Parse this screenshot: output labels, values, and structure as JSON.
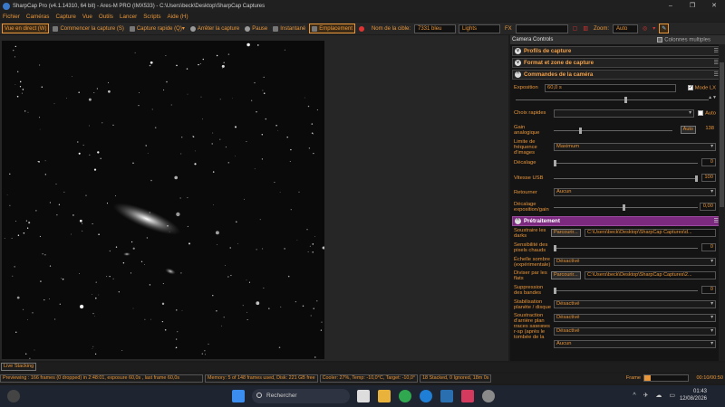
{
  "window": {
    "title": "SharpCap Pro (v4.1.14310, 64 bit) - Ares-M PRO (IMX533) - C:\\Users\\beck\\Desktop\\SharpCap Captures",
    "controls": [
      "–",
      "❐",
      "✕"
    ]
  },
  "menu": [
    "Fichier",
    "Caméras",
    "Capture",
    "Vue",
    "Outils",
    "Lancer",
    "Scripts",
    "Aide (H)"
  ],
  "toolbar": {
    "live_view": "Vue en direct (W)",
    "start_capture": "Commencer la capture (S)",
    "quick_capture": "Capture rapide (Q)",
    "stop_capture": "Arrêter la capture",
    "pause": "Pause",
    "snapshot": "Instantané",
    "framing": "Emplacement",
    "target_label": "Nom de la cible:",
    "target_value": "7331 bleu",
    "frame_type": "Lights",
    "fx_label": "FX",
    "zoom_label": "Zoom:",
    "zoom_value": "Auto"
  },
  "panel": {
    "header": "Camera Controls",
    "multi_columns": "Colonnes multiples",
    "sections": {
      "profiles": "Profils de capture",
      "format": "Format et zone de capture",
      "camera": "Commandes de la caméra",
      "preprocessing": "Prétraitement"
    },
    "camera_controls": {
      "exposure_label": "Exposition",
      "exposure_value": "60,0 s",
      "lx_mode": "Mode LX",
      "lx_checked": true,
      "quick_choice": "Choix rapides",
      "auto_label": "Auto",
      "gain_label": "Gain analogique",
      "gain_auto": "Auto",
      "gain_value": "138",
      "framerate_label": "Limite de fréquence d'images",
      "framerate_value": "Maximum",
      "offset_label": "Décalage",
      "offset_value": "0",
      "usb_label": "Vitesse USB",
      "usb_value": "100",
      "flip_label": "Retourner",
      "flip_value": "Aucun",
      "expgain_label": "Décalage exposition/gain",
      "expgain_value": "0,00"
    },
    "preprocessing": {
      "darks_label": "Soustraire les darks",
      "browse": "Parcourir...",
      "darks_path": "C:\\Users\\beck\\Desktop\\SharpCap Captures\\d...",
      "hotpix_label": "Sensibilité des pixels chauds",
      "hotpix_value": "0",
      "darkscale_label": "Échelle sombre (expérimentale)",
      "darkscale_value": "Désactivé",
      "flats_label": "Diviser par les flats",
      "flats_path": "C:\\Users\\beck\\Desktop\\SharpCap Captures\\2...",
      "banding_label": "Suppression des bandes",
      "banding_value": "0",
      "stab_label": "Stabilisation planète / disque",
      "stab_value": "Désactivé",
      "bg_label": "Soustraction d'arrière plan",
      "bg_value": "Désactivé",
      "sat_label": "Supprimer les traces satellites r-sp (après le tombée de la nuit)",
      "sat_value": "Désactivé",
      "last_value": "Aucun"
    }
  },
  "live_stacking": "Live Stacking",
  "status": {
    "preview": "Previewing : 166 frames (0 dropped) in 2:48:01, exposure 60,0s , last frame 60,0s",
    "memory": "Memory: 5 of 148 frames used, Disk: 221 GB free",
    "cooler": "Cooler: 27%, Temp: -10,0°C, Target: -10,0°",
    "stacked": "18 Stacked, 0 Ignored, 18m 0s",
    "frame_label": "Frame",
    "frame_progress": 0.14,
    "timer": "00:10/00:50"
  },
  "taskbar": {
    "search_placeholder": "Rechercher",
    "time": "01:43",
    "date": "12/08/2026"
  },
  "colors": {
    "accent": "#e8963a",
    "purple_section": "#7b2a80",
    "background": "#1b1b1b"
  }
}
